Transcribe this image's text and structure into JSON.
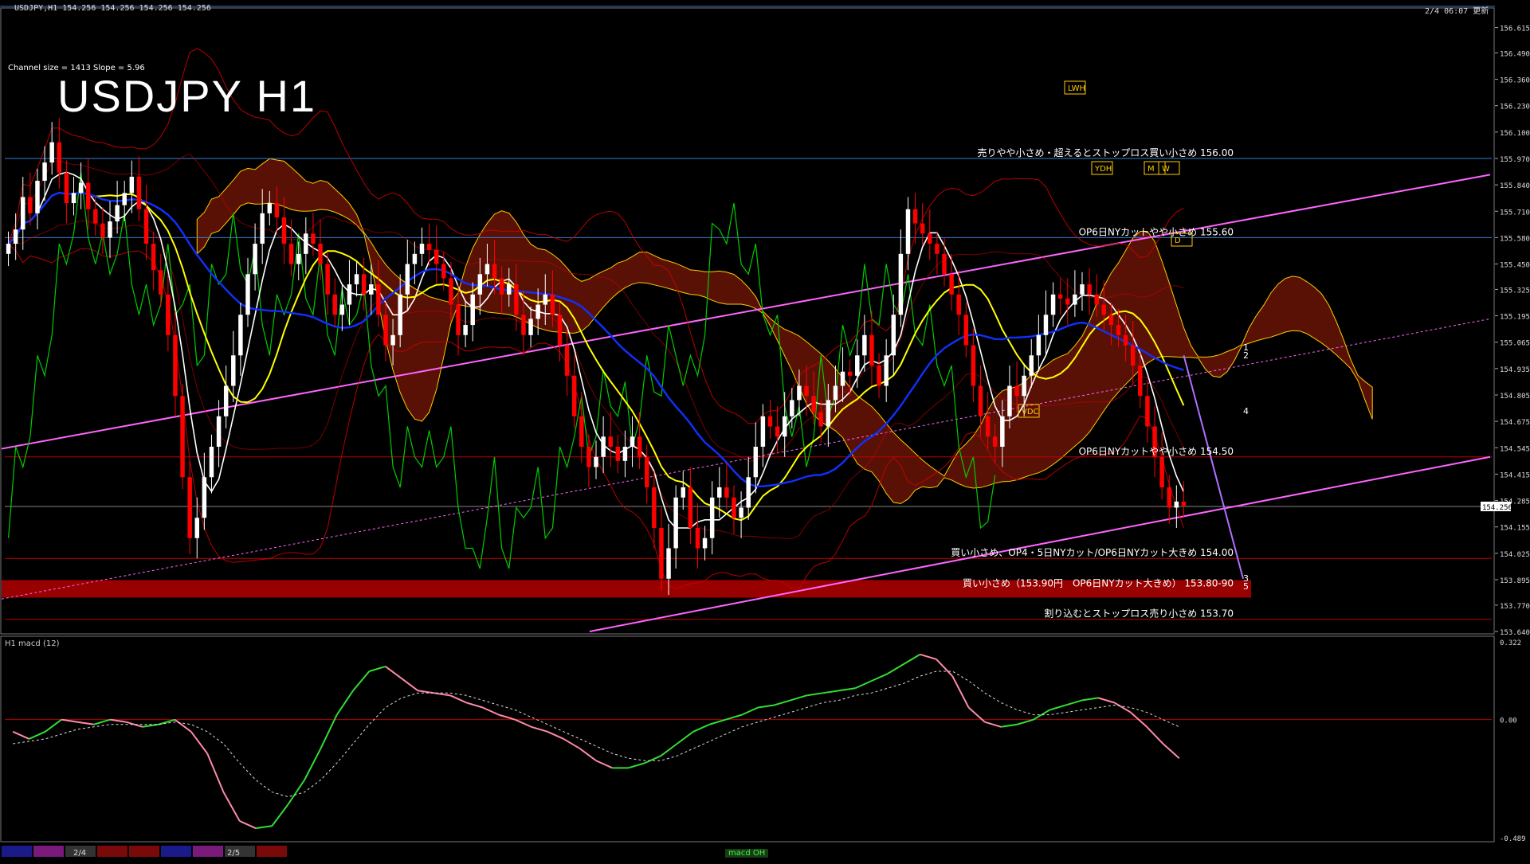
{
  "header": {
    "symbol_info": "USDJPY,H1  154.256 154.256 154.256 154.256",
    "updated": "2/4 06:07 更新"
  },
  "title": "USDJPY H1",
  "channel_info": "Channel size = 1413 Slope = 5.96",
  "indicator_label": "H1  macd (12)",
  "bottom": {
    "dates": [
      "2/4",
      "2/5"
    ],
    "tab": "macd OH"
  },
  "colors": {
    "background": "#000000",
    "bull_candle": "#ffffff",
    "bear_candle": "#ff0000",
    "ma_white": "#ffffff",
    "ma_yellow": "#ffff00",
    "ma_blue": "#1030ff",
    "chikou_green": "#00cc00",
    "bollinger_red": "#cc0000",
    "kumo": "#ff3010",
    "channel": "#ff66ff",
    "level_blue": "#3a7bd5",
    "level_red": "#c00000",
    "macd_up": "#33dd33",
    "macd_down": "#ff8aa8",
    "signal": "#dddddd"
  },
  "chart_data": [
    {
      "type": "candlestick",
      "ylim": [
        153.64,
        156.68
      ],
      "y_ticks": [
        "156.615",
        "156.490",
        "156.360",
        "156.230",
        "156.100",
        "155.970",
        "155.840",
        "155.710",
        "155.580",
        "155.450",
        "155.325",
        "155.195",
        "155.065",
        "154.935",
        "154.805",
        "154.675",
        "154.545",
        "154.415",
        "154.285",
        "154.155",
        "154.025",
        "153.895",
        "153.770",
        "153.640"
      ],
      "current_price": "154.256",
      "closes": [
        155.55,
        155.62,
        155.78,
        155.7,
        155.86,
        155.95,
        156.05,
        155.9,
        155.75,
        155.8,
        155.85,
        155.72,
        155.65,
        155.58,
        155.66,
        155.74,
        155.8,
        155.88,
        155.72,
        155.55,
        155.42,
        155.3,
        155.1,
        154.8,
        154.4,
        154.1,
        154.2,
        154.4,
        154.55,
        154.7,
        154.85,
        155.0,
        155.2,
        155.4,
        155.55,
        155.7,
        155.75,
        155.68,
        155.55,
        155.45,
        155.5,
        155.6,
        155.55,
        155.45,
        155.3,
        155.2,
        155.25,
        155.35,
        155.4,
        155.3,
        155.35,
        155.2,
        155.05,
        155.1,
        155.3,
        155.45,
        155.5,
        155.55,
        155.52,
        155.45,
        155.38,
        155.25,
        155.1,
        155.15,
        155.3,
        155.4,
        155.45,
        155.38,
        155.3,
        155.35,
        155.2,
        155.1,
        155.18,
        155.25,
        155.3,
        155.2,
        155.05,
        154.9,
        154.7,
        154.55,
        154.45,
        154.5,
        154.6,
        154.55,
        154.48,
        154.55,
        154.6,
        154.5,
        154.35,
        154.15,
        153.9,
        154.05,
        154.3,
        154.35,
        154.15,
        154.05,
        154.1,
        154.3,
        154.35,
        154.3,
        154.2,
        154.25,
        154.4,
        154.55,
        154.7,
        154.65,
        154.6,
        154.7,
        154.78,
        154.85,
        154.8,
        154.72,
        154.65,
        154.78,
        154.85,
        154.92,
        154.9,
        155.0,
        155.1,
        154.95,
        154.85,
        155.0,
        155.2,
        155.5,
        155.72,
        155.65,
        155.6,
        155.55,
        155.5,
        155.4,
        155.3,
        155.2,
        155.05,
        154.85,
        154.7,
        154.6,
        154.55,
        154.7,
        154.85,
        154.8,
        154.9,
        155.0,
        155.1,
        155.2,
        155.3,
        155.28,
        155.25,
        155.3,
        155.35,
        155.3,
        155.25,
        155.2,
        155.15,
        155.1,
        155.05,
        154.95,
        154.8,
        154.65,
        154.5,
        154.35,
        154.25,
        154.28,
        154.26
      ],
      "levels": [
        {
          "price": 155.97,
          "color": "#3a7bd5",
          "label": "売りやや小さめ・超えるとストップロス買い小さめ 156.00"
        },
        {
          "price": 155.58,
          "color": "#3a7bd5",
          "label": "OP6日NYカットやや小さめ 155.60"
        },
        {
          "price": 154.5,
          "color": "#c00000",
          "label": "OP6日NYカットやや小さめ 154.50"
        },
        {
          "price": 154.0,
          "color": "#c00000",
          "label": "買い小さめ、OP4・5日NYカット/OP6日NYカット大きめ 154.00"
        },
        {
          "price": 153.85,
          "color": "#990000",
          "label": "買い小さめ（153.90円　OP6日NYカット大きめ） 153.80-90",
          "band": true
        },
        {
          "price": 153.7,
          "color": "#c00000",
          "label": "割り込むとストップロス売り小さめ 153.70"
        }
      ],
      "markers": [
        "LWH",
        "YDH",
        "M",
        "W",
        "D",
        "VDC"
      ],
      "wave_labels": [
        "1",
        "2",
        "3",
        "4",
        "5"
      ]
    },
    {
      "type": "line",
      "name": "macd (12)",
      "ylim": [
        -0.489,
        0.322
      ],
      "y_ticks": [
        "0.322",
        "0.00",
        "-0.489"
      ],
      "macd": [
        -0.05,
        -0.08,
        -0.05,
        0.0,
        -0.01,
        -0.02,
        0.0,
        -0.01,
        -0.03,
        -0.02,
        0.0,
        -0.05,
        -0.14,
        -0.3,
        -0.42,
        -0.45,
        -0.44,
        -0.35,
        -0.25,
        -0.12,
        0.02,
        0.12,
        0.2,
        0.22,
        0.17,
        0.12,
        0.11,
        0.1,
        0.07,
        0.05,
        0.02,
        0.0,
        -0.03,
        -0.05,
        -0.08,
        -0.12,
        -0.17,
        -0.2,
        -0.2,
        -0.18,
        -0.15,
        -0.1,
        -0.05,
        -0.02,
        0.0,
        0.02,
        0.05,
        0.06,
        0.08,
        0.1,
        0.11,
        0.12,
        0.13,
        0.16,
        0.19,
        0.23,
        0.27,
        0.25,
        0.18,
        0.05,
        -0.01,
        -0.03,
        -0.02,
        0.0,
        0.04,
        0.06,
        0.08,
        0.09,
        0.07,
        0.03,
        -0.03,
        -0.1,
        -0.16
      ],
      "signal": [
        -0.1,
        -0.09,
        -0.08,
        -0.06,
        -0.04,
        -0.03,
        -0.02,
        -0.02,
        -0.02,
        -0.02,
        -0.01,
        -0.02,
        -0.05,
        -0.1,
        -0.18,
        -0.25,
        -0.3,
        -0.32,
        -0.3,
        -0.25,
        -0.18,
        -0.1,
        -0.02,
        0.05,
        0.09,
        0.11,
        0.11,
        0.11,
        0.1,
        0.08,
        0.06,
        0.04,
        0.01,
        -0.02,
        -0.05,
        -0.08,
        -0.11,
        -0.14,
        -0.16,
        -0.17,
        -0.17,
        -0.15,
        -0.12,
        -0.09,
        -0.06,
        -0.03,
        -0.01,
        0.01,
        0.03,
        0.05,
        0.07,
        0.08,
        0.1,
        0.11,
        0.13,
        0.15,
        0.18,
        0.2,
        0.2,
        0.16,
        0.11,
        0.07,
        0.04,
        0.02,
        0.02,
        0.03,
        0.04,
        0.05,
        0.06,
        0.05,
        0.03,
        0.0,
        -0.03
      ]
    }
  ]
}
